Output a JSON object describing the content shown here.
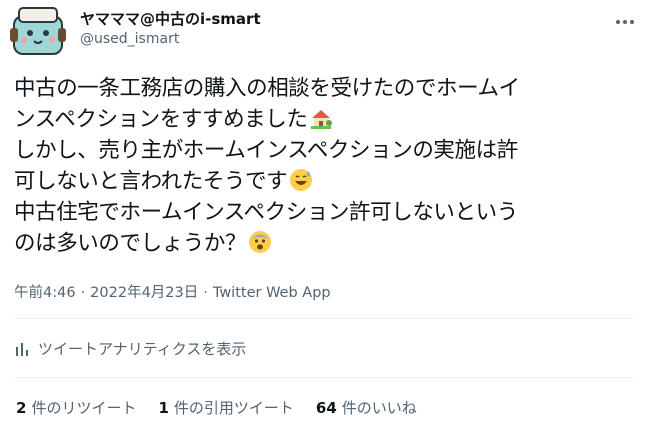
{
  "author": {
    "display_name": "ヤマママ@中古のi-smart",
    "handle": "@used_ismart"
  },
  "tweet": {
    "lines": [
      "中古の一条工務店の購入の相談を受けたのでホームイ",
      "ンスペクションをすすめました",
      "しかし、売り主がホームインスペクションの実施は許",
      "可しないと言われたそうです",
      "中古住宅でホームインスペクション許可しないという",
      "のは多いのでしょうか？"
    ],
    "emojis": [
      "house-with-garden-emoji",
      "grinning-sweat-emoji",
      "fearful-face-emoji"
    ]
  },
  "meta": {
    "time": "午前4:46",
    "date": "2022年4月23日",
    "source": "Twitter Web App",
    "separator": "·"
  },
  "analytics": {
    "label": "ツイートアナリティクスを表示",
    "icon": "bar-chart-icon"
  },
  "stats": [
    {
      "count": "2",
      "label": "件のリツイート"
    },
    {
      "count": "1",
      "label": "件の引用ツイート"
    },
    {
      "count": "64",
      "label": "件のいいね"
    }
  ],
  "colors": {
    "text": "#0f1419",
    "secondary": "#536471",
    "divider": "#eff3f4"
  }
}
